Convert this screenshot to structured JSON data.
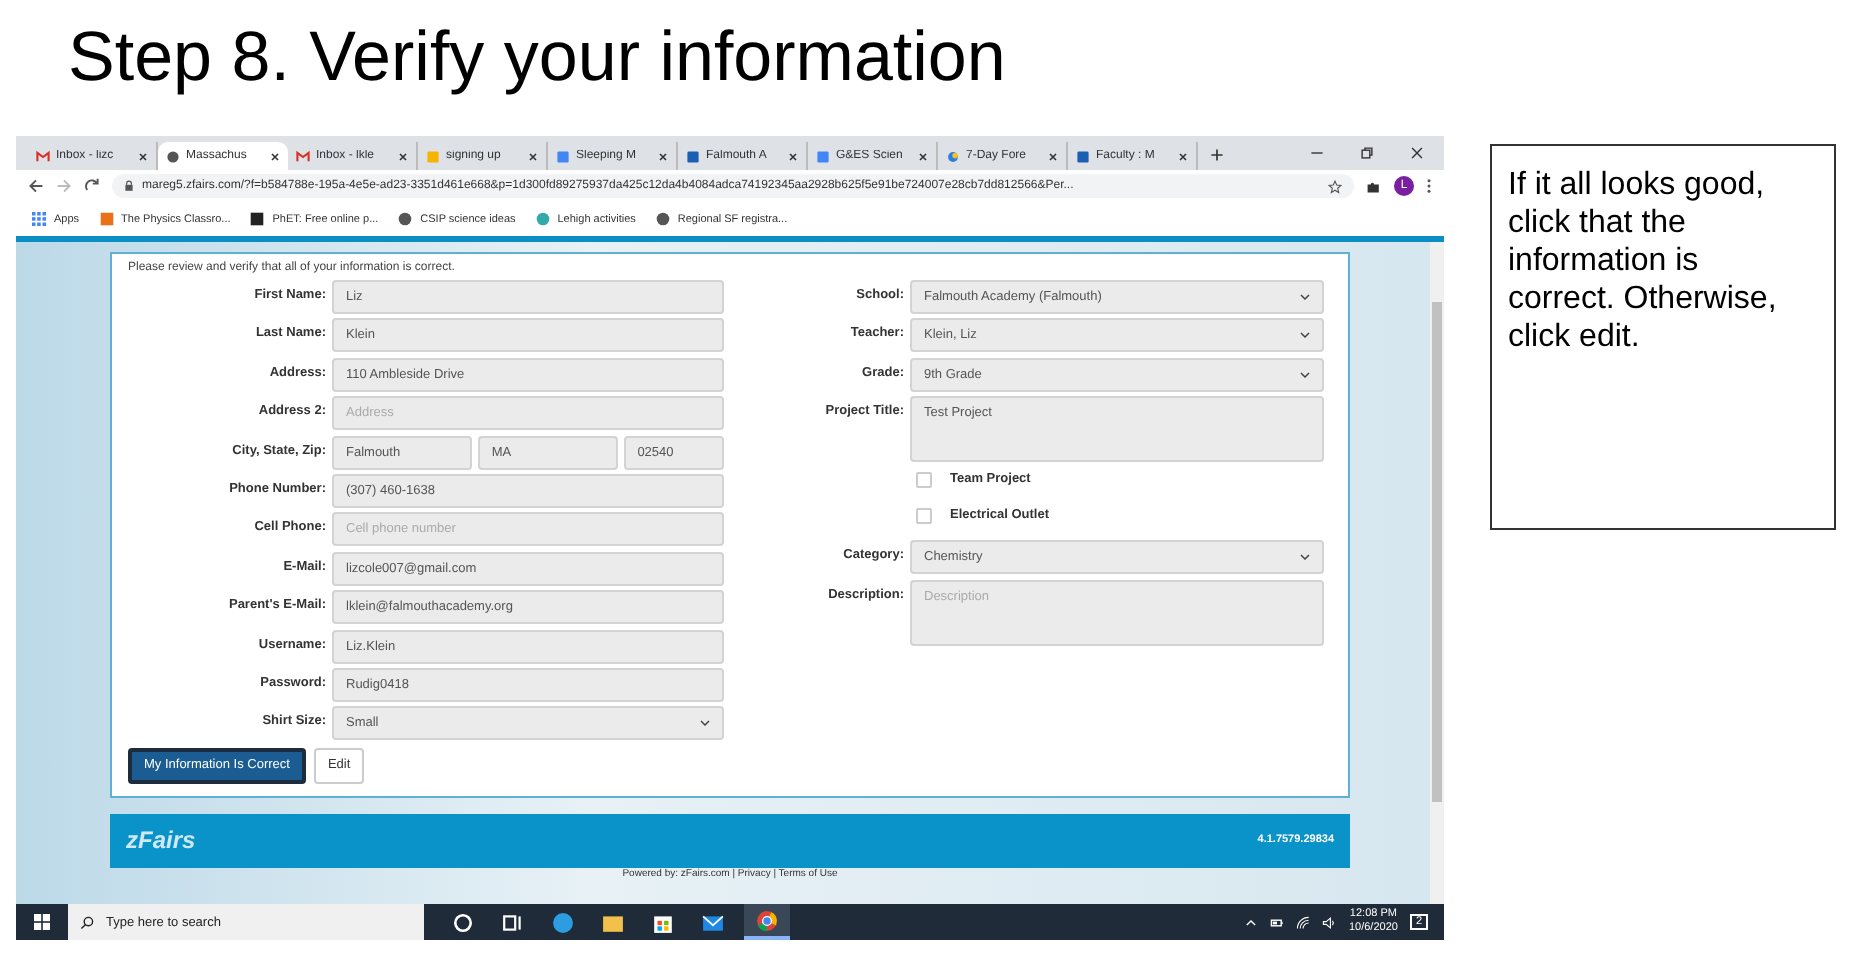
{
  "slide_title": "Step 8. Verify your information",
  "callout": "If it all looks good, click that the information is correct. Otherwise, click edit.",
  "browser": {
    "tabs": [
      {
        "label": "Inbox - lizc",
        "kind": "gmail",
        "selected": false
      },
      {
        "label": "Massachus",
        "kind": "globe",
        "selected": true
      },
      {
        "label": "Inbox - lkle",
        "kind": "gmail",
        "selected": false
      },
      {
        "label": "signing up",
        "kind": "slides",
        "selected": false
      },
      {
        "label": "Sleeping M",
        "kind": "docs",
        "selected": false
      },
      {
        "label": "Falmouth A",
        "kind": "site",
        "selected": false
      },
      {
        "label": "G&ES Scien",
        "kind": "docs",
        "selected": false
      },
      {
        "label": "7-Day Fore",
        "kind": "weather",
        "selected": false
      },
      {
        "label": "Faculty : M",
        "kind": "site",
        "selected": false
      }
    ],
    "url": "mareg5.zfairs.com/?f=b584788e-195a-4e5e-ad23-3351d461e668&p=1d300fd89275937da425c12da4b4084adca74192345aa2928b625f5e91be724007e28cb7dd812566&Per...",
    "profile": "L",
    "bookmarks": [
      {
        "label": "Apps",
        "kind": "apps"
      },
      {
        "label": "The Physics Classro...",
        "kind": "orange"
      },
      {
        "label": "PhET: Free online p...",
        "kind": "phet"
      },
      {
        "label": "CSIP science ideas",
        "kind": "globe"
      },
      {
        "label": "Lehigh activities",
        "kind": "lehigh"
      },
      {
        "label": "Regional SF registra...",
        "kind": "globe"
      }
    ]
  },
  "form": {
    "intro": "Please review and verify that all of your information is correct.",
    "left_fields": [
      {
        "label": "First Name:",
        "kind": "text",
        "value": "Liz"
      },
      {
        "label": "Last Name:",
        "kind": "text",
        "value": "Klein"
      },
      {
        "label": "Address:",
        "kind": "text",
        "value": "110 Ambleside Drive"
      },
      {
        "label": "Address 2:",
        "kind": "text",
        "placeholder": "Address"
      },
      {
        "label": "City, State, Zip:",
        "kind": "triple",
        "values": [
          "Falmouth",
          "MA",
          "02540"
        ]
      },
      {
        "label": "Phone Number:",
        "kind": "text",
        "value": "(307) 460-1638"
      },
      {
        "label": "Cell Phone:",
        "kind": "text",
        "placeholder": "Cell phone number"
      },
      {
        "label": "E-Mail:",
        "kind": "text",
        "value": "lizcole007@gmail.com"
      },
      {
        "label": "Parent's E-Mail:",
        "kind": "text",
        "value": "lklein@falmouthacademy.org"
      },
      {
        "label": "Username:",
        "kind": "text",
        "value": "Liz.Klein"
      },
      {
        "label": "Password:",
        "kind": "text",
        "value": "Rudig0418"
      },
      {
        "label": "Shirt Size:",
        "kind": "select",
        "value": "Small"
      }
    ],
    "right_fields": [
      {
        "label": "School:",
        "kind": "select",
        "value": "Falmouth Academy (Falmouth)"
      },
      {
        "label": "Teacher:",
        "kind": "select",
        "value": "Klein, Liz"
      },
      {
        "label": "Grade:",
        "kind": "select",
        "value": "9th Grade"
      },
      {
        "label": "Project Title:",
        "kind": "textarea",
        "value": "Test Project"
      },
      {
        "label": "Team Project",
        "kind": "checkbox",
        "checked": false
      },
      {
        "label": "Electrical Outlet",
        "kind": "checkbox",
        "checked": false
      },
      {
        "label": "Category:",
        "kind": "select",
        "value": "Chemistry"
      },
      {
        "label": "Description:",
        "kind": "textarea",
        "placeholder": "Description"
      }
    ],
    "buttons": [
      {
        "label": "My Information Is Correct",
        "kind": "primary"
      },
      {
        "label": "Edit",
        "kind": "default"
      }
    ]
  },
  "footer": {
    "logo": "zFairs",
    "version": "4.1.7579.29834",
    "powered": "Powered by: zFairs.com | Privacy | Terms of Use"
  },
  "taskbar": {
    "search_placeholder": "Type here to search",
    "time": "12:08 PM",
    "date": "10/6/2020",
    "notifications": "2"
  }
}
